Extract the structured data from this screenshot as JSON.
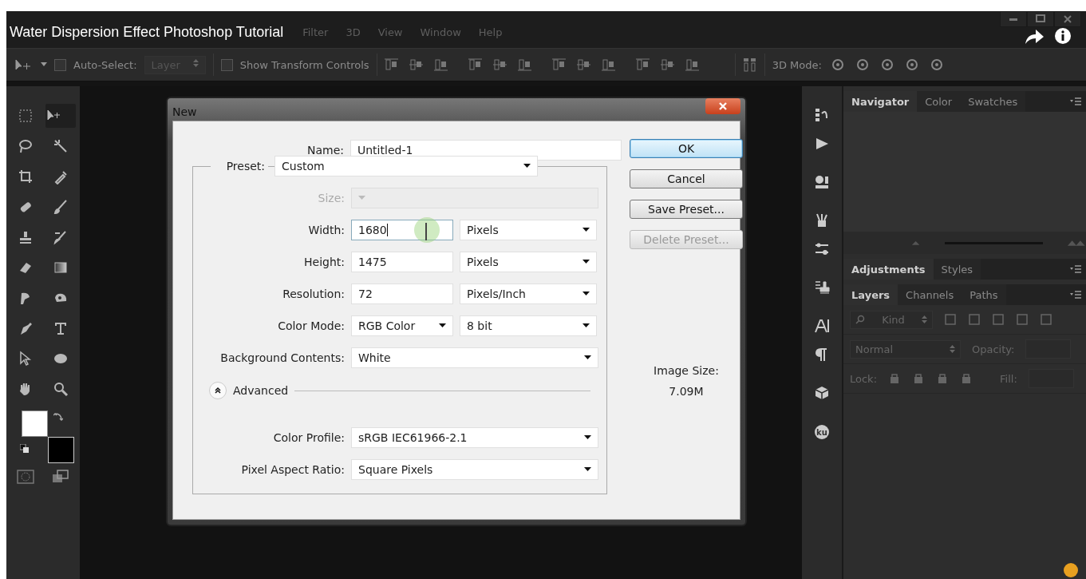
{
  "video": {
    "title": "Water Dispersion Effect Photoshop Tutorial"
  },
  "menu": [
    "Filter",
    "3D",
    "View",
    "Window",
    "Help"
  ],
  "options_bar": {
    "auto_select": {
      "label": "Auto-Select:",
      "checked": false,
      "value": "Layer"
    },
    "show_transform": {
      "label": "Show Transform Controls",
      "checked": false
    },
    "mode_label": "3D Mode:"
  },
  "tools": [
    {
      "selected": false
    },
    {
      "selected": true
    },
    {
      "selected": false
    },
    {
      "selected": false
    },
    {
      "selected": false
    },
    {
      "selected": false
    },
    {
      "selected": false
    },
    {
      "selected": false
    },
    {
      "selected": false
    },
    {
      "selected": false
    },
    {
      "selected": false
    },
    {
      "selected": false
    },
    {
      "selected": false
    },
    {
      "selected": false
    },
    {
      "selected": false
    },
    {
      "selected": false
    },
    {
      "selected": false
    },
    {
      "selected": false
    },
    {
      "selected": false
    },
    {
      "selected": false
    }
  ],
  "dialog": {
    "title": "New",
    "name": {
      "label": "Name:",
      "value": "Untitled-1"
    },
    "fields": [
      {
        "kind": "select",
        "label": "Preset:",
        "value": "Custom",
        "disabled": false
      },
      {
        "kind": "select",
        "label": "Size:",
        "disabled": true
      },
      {
        "kind": "pair",
        "label": "Width:",
        "value": "1680",
        "unit": "Pixels",
        "focused": true
      },
      {
        "kind": "pair",
        "label": "Height:",
        "value": "1475",
        "unit": "Pixels",
        "focused": false
      },
      {
        "kind": "pair",
        "label": "Resolution:",
        "value": "72",
        "unit": "Pixels/Inch",
        "focused": false
      },
      {
        "kind": "selectpair",
        "label": "Color Mode:",
        "value": "RGB Color",
        "unit": "8 bit"
      },
      {
        "kind": "select",
        "label": "Background Contents:",
        "value": "White",
        "disabled": false
      },
      {
        "kind": "advanced",
        "label": "Advanced",
        "expanded": true
      },
      {
        "kind": "select",
        "label": "Color Profile:",
        "value": "sRGB IEC61966-2.1",
        "disabled": false
      },
      {
        "kind": "select",
        "label": "Pixel Aspect Ratio:",
        "value": "Square Pixels",
        "disabled": false
      }
    ],
    "buttons": [
      {
        "label": "OK",
        "default": true,
        "disabled": false
      },
      {
        "label": "Cancel",
        "default": false,
        "disabled": false
      },
      {
        "label": "Save Preset...",
        "default": false,
        "disabled": false
      },
      {
        "label": "Delete Preset...",
        "default": false,
        "disabled": true
      }
    ],
    "image_size": {
      "label": "Image Size:",
      "value": "7.09M"
    }
  },
  "dock": {
    "badge": "ku"
  },
  "panels": [
    {
      "tabs": [
        {
          "label": "Navigator",
          "selected": true
        },
        {
          "label": "Color",
          "selected": false
        },
        {
          "label": "Swatches",
          "selected": false
        }
      ]
    },
    {
      "tabs": [
        {
          "label": "Adjustments",
          "selected": true
        },
        {
          "label": "Styles",
          "selected": false
        }
      ]
    },
    {
      "tabs": [
        {
          "label": "Layers",
          "selected": true
        },
        {
          "label": "Channels",
          "selected": false
        },
        {
          "label": "Paths",
          "selected": false
        }
      ]
    }
  ],
  "layers": {
    "filter": "Kind",
    "blend_mode": "Normal",
    "opacity_label": "Opacity:",
    "lock_label": "Lock:",
    "fill_label": "Fill:"
  }
}
